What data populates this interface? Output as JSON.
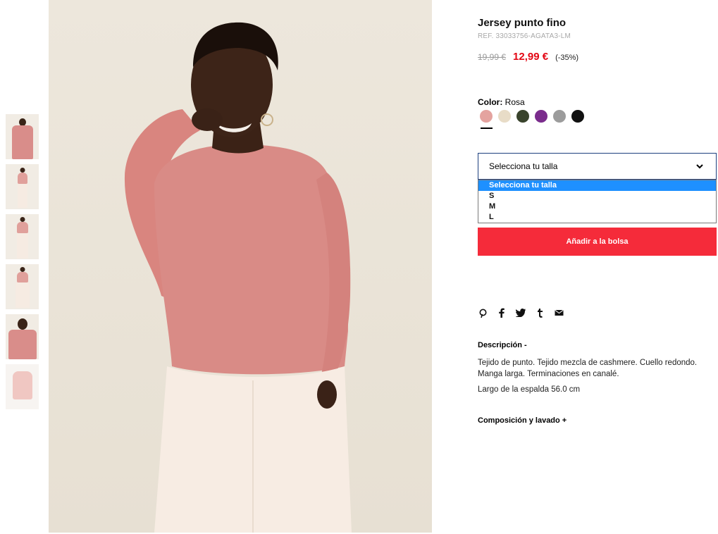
{
  "product": {
    "title": "Jersey punto fino",
    "ref": "REF. 33033756-AGATA3-LM",
    "old_price": "19,99 €",
    "new_price": "12,99 €",
    "discount": "(-35%)"
  },
  "color": {
    "label": "Color:",
    "value": "Rosa",
    "swatches": [
      {
        "name": "rosa",
        "hex": "#e4a39f"
      },
      {
        "name": "beige",
        "hex": "#e8dcc7"
      },
      {
        "name": "verde",
        "hex": "#39432c"
      },
      {
        "name": "morado",
        "hex": "#7a2c8c"
      },
      {
        "name": "gris",
        "hex": "#9c9c9c"
      },
      {
        "name": "negro",
        "hex": "#111111"
      }
    ]
  },
  "size": {
    "select_label": "Selecciona tu talla",
    "options": [
      "Selecciona tu talla",
      "S",
      "M",
      "L"
    ],
    "selected_index": 0
  },
  "add_button": "Añadir a la bolsa",
  "social": [
    "pinterest-icon",
    "facebook-icon",
    "twitter-icon",
    "tumblr-icon",
    "email-icon"
  ],
  "description": {
    "heading": "Descripción -",
    "text": "Tejido de punto. Tejido mezcla de cashmere. Cuello redondo. Manga larga. Terminaciones en canalé.",
    "length": "Largo de la espalda 56.0 cm"
  },
  "composition_heading": "Composición y lavado +",
  "colors": {
    "accent": "#f52b3a",
    "price_red": "#e30613",
    "select_border": "#1c3f7e",
    "highlight": "#1e90ff"
  }
}
